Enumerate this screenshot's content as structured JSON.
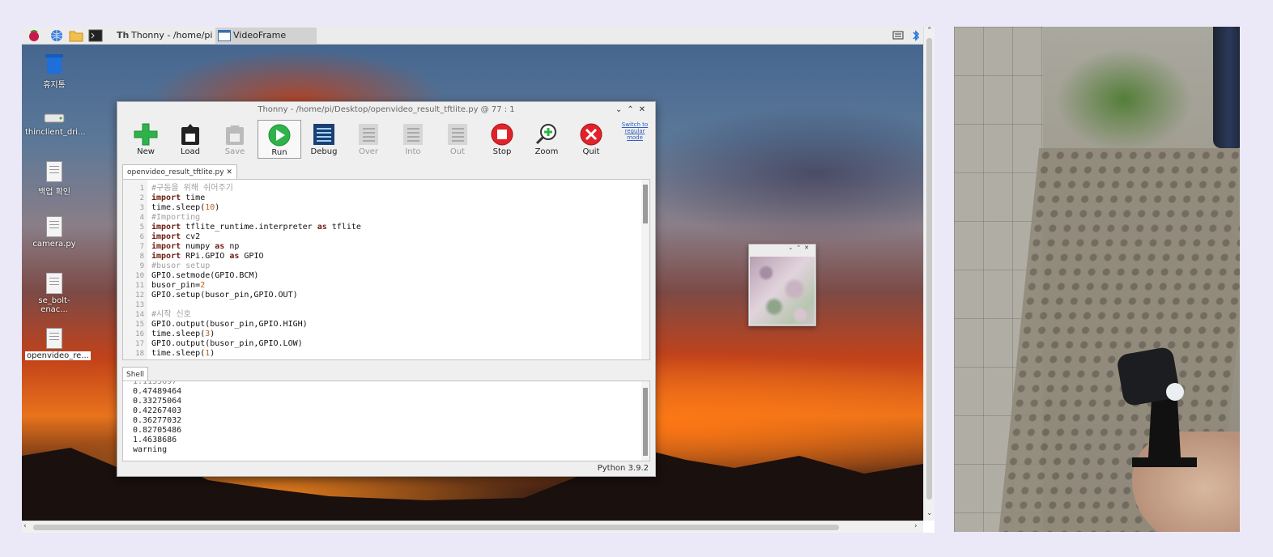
{
  "taskbar": {
    "tasks": [
      {
        "label": "Thonny  -  /home/pi/..."
      },
      {
        "label": "VideoFrame"
      }
    ]
  },
  "desktop_icons": [
    {
      "label": "휴지통",
      "icon": "trash-icon"
    },
    {
      "label": "thinclient_dri...",
      "icon": "drive-icon"
    },
    {
      "label": "백업 확인",
      "icon": "document-icon"
    },
    {
      "label": "camera.py",
      "icon": "document-icon"
    },
    {
      "label": "se_bolt-enac...",
      "icon": "document-icon"
    },
    {
      "label": "openvideo_re...",
      "icon": "document-icon"
    }
  ],
  "thonny": {
    "title": "Thonny  -  /home/pi/Desktop/openvideo_result_tftlite.py  @  77 : 1",
    "toolbar": [
      {
        "label": "New",
        "icon": "new-icon",
        "enabled": true
      },
      {
        "label": "Load",
        "icon": "load-icon",
        "enabled": true
      },
      {
        "label": "Save",
        "icon": "save-icon",
        "enabled": false
      },
      {
        "label": "Run",
        "icon": "run-icon",
        "enabled": true
      },
      {
        "label": "Debug",
        "icon": "debug-icon",
        "enabled": true
      },
      {
        "label": "Over",
        "icon": "step-over-icon",
        "enabled": false
      },
      {
        "label": "Into",
        "icon": "step-into-icon",
        "enabled": false
      },
      {
        "label": "Out",
        "icon": "step-out-icon",
        "enabled": false
      },
      {
        "label": "Stop",
        "icon": "stop-icon",
        "enabled": true
      },
      {
        "label": "Zoom",
        "icon": "zoom-icon",
        "enabled": true
      },
      {
        "label": "Quit",
        "icon": "quit-icon",
        "enabled": true
      }
    ],
    "switch_mode": "Switch to regular mode",
    "editor_tab": "openvideo_result_tftlite.py ✕",
    "code": [
      {
        "n": "1",
        "t": "#구동을 위해 쉬어주기"
      },
      {
        "n": "2",
        "t": "import time"
      },
      {
        "n": "3",
        "t": "time.sleep(10)"
      },
      {
        "n": "4",
        "t": "#Importing"
      },
      {
        "n": "5",
        "t": "import tflite_runtime.interpreter as tflite"
      },
      {
        "n": "6",
        "t": "import cv2"
      },
      {
        "n": "7",
        "t": "import numpy as np"
      },
      {
        "n": "8",
        "t": "import RPi.GPIO as GPIO"
      },
      {
        "n": "9",
        "t": "#busor setup"
      },
      {
        "n": "10",
        "t": "GPIO.setmode(GPIO.BCM)"
      },
      {
        "n": "11",
        "t": "busor_pin=2"
      },
      {
        "n": "12",
        "t": "GPIO.setup(busor_pin,GPIO.OUT)"
      },
      {
        "n": "13",
        "t": ""
      },
      {
        "n": "14",
        "t": "#시작 신호"
      },
      {
        "n": "15",
        "t": "GPIO.output(busor_pin,GPIO.HIGH)"
      },
      {
        "n": "16",
        "t": "time.sleep(3)"
      },
      {
        "n": "17",
        "t": "GPIO.output(busor_pin,GPIO.LOW)"
      },
      {
        "n": "18",
        "t": "time.sleep(1)"
      }
    ],
    "shell_tab": "Shell",
    "shell_lines": [
      "0.47489464",
      "0.33275064",
      "0.42267403",
      "0.36277032",
      "0.82705486",
      "1.4638686",
      "warning"
    ],
    "status": "Python 3.9.2"
  },
  "colors": {
    "accent_green": "#2db34a",
    "stop_red": "#e0232a",
    "keyword": "#6b1d10",
    "comment": "#a0a0a0",
    "number": "#c06020",
    "link": "#2f5fbf"
  }
}
